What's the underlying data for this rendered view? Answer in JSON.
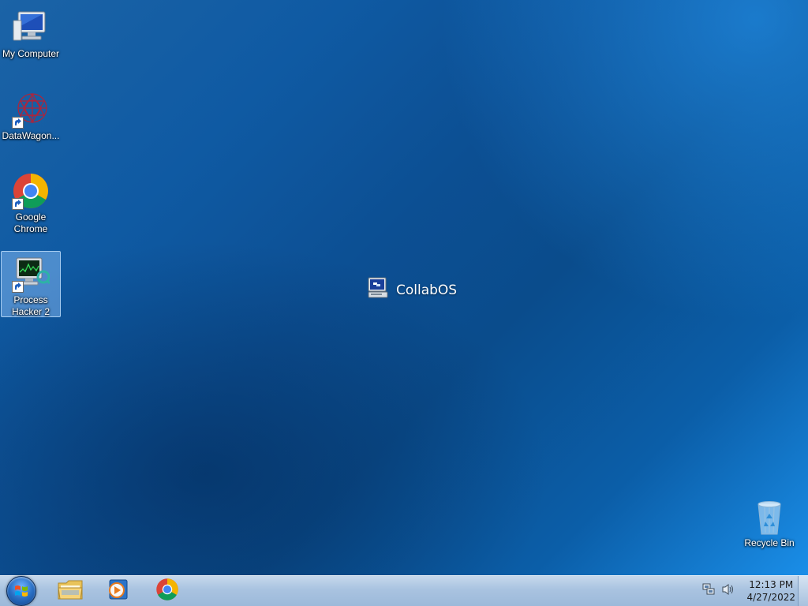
{
  "desktop": {
    "icons": [
      {
        "label": "My Computer",
        "icon": "computer-icon",
        "shortcut": false,
        "selected": false
      },
      {
        "label": "DataWagon...",
        "icon": "datawagon-icon",
        "shortcut": true,
        "selected": false
      },
      {
        "label": "Google Chrome",
        "icon": "chrome-icon",
        "shortcut": true,
        "selected": false
      },
      {
        "label": "Process Hacker 2",
        "icon": "process-hacker-icon",
        "shortcut": true,
        "selected": true
      }
    ],
    "recycle_bin": {
      "label": "Recycle Bin",
      "icon": "recycle-bin-icon"
    },
    "center_label": {
      "text": "CollabOS",
      "icon": "terminal-computer-icon"
    }
  },
  "taskbar": {
    "start": {
      "icon": "windows-logo-icon"
    },
    "pinned": [
      {
        "name": "file-explorer",
        "icon": "folder-icon"
      },
      {
        "name": "media-player",
        "icon": "media-player-icon"
      },
      {
        "name": "chrome",
        "icon": "chrome-icon"
      }
    ],
    "tray": {
      "network_icon": "network-icon",
      "volume_icon": "speaker-icon",
      "time": "12:13 PM",
      "date": "4/27/2022"
    }
  },
  "colors": {
    "desktop_bg": "#0c4f93",
    "taskbar_bg": "#a9c3e0",
    "selection": "#96c8ff"
  }
}
